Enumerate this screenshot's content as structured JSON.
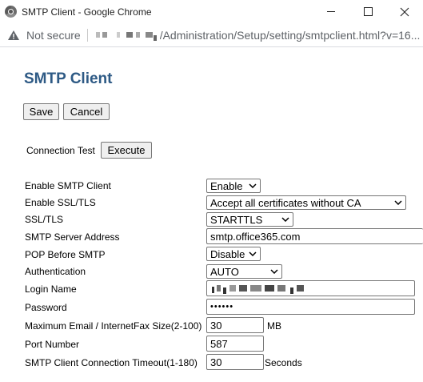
{
  "window": {
    "title": "SMTP Client - Google Chrome",
    "icon": "chrome-icon"
  },
  "addressbar": {
    "security_label": "Not secure",
    "url_visible": "/Administration/Setup/setting/smtpclient.html?v=16..."
  },
  "page": {
    "title": "SMTP Client",
    "title_color": "#2e5a85",
    "save_label": "Save",
    "cancel_label": "Cancel",
    "connection_test_label": "Connection Test",
    "execute_label": "Execute"
  },
  "form": {
    "enable_smtp": {
      "label": "Enable SMTP Client",
      "value": "Enable"
    },
    "enable_ssl": {
      "label": "Enable SSL/TLS",
      "value": "Accept all certificates without CA"
    },
    "ssl_tls": {
      "label": "SSL/TLS",
      "value": "STARTTLS"
    },
    "server_address": {
      "label": "SMTP Server Address",
      "value": "smtp.office365.com"
    },
    "pop_before_smtp": {
      "label": "POP Before SMTP",
      "value": "Disable"
    },
    "authentication": {
      "label": "Authentication",
      "value": "AUTO"
    },
    "login_name": {
      "label": "Login Name"
    },
    "password": {
      "label": "Password",
      "value": "••••••"
    },
    "max_email_size": {
      "label": "Maximum Email / InternetFax Size(2-100)",
      "value": "30",
      "unit": "MB"
    },
    "port_number": {
      "label": "Port Number",
      "value": "587"
    },
    "timeout": {
      "label": "SMTP Client Connection Timeout(1-180)",
      "value": "30",
      "unit": "Seconds"
    }
  }
}
